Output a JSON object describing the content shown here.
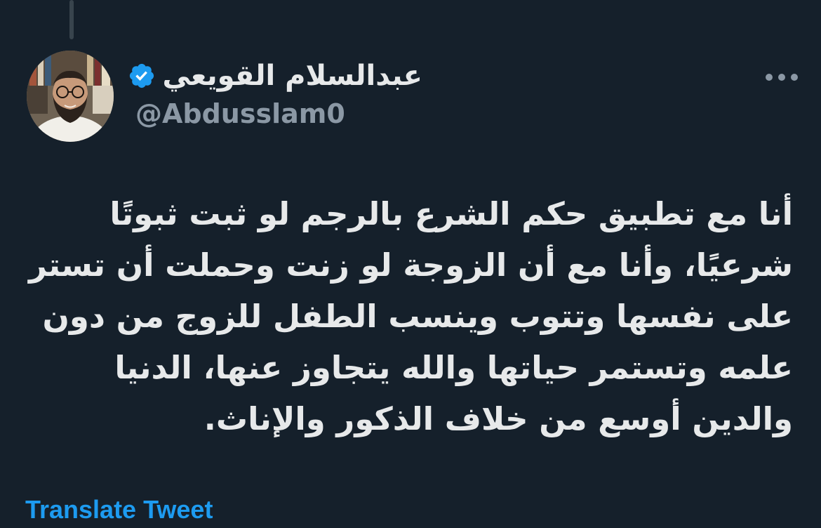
{
  "author": {
    "display_name": "عبدالسلام القويعي",
    "handle": "@Abdusslam0",
    "verified": true,
    "avatar_icon": "user-avatar-photo",
    "verified_icon": "verified-badge-icon"
  },
  "tweet": {
    "text": "أنا مع تطبيق حكم الشرع بالرجم لو ثبت ثبوتًا\nشرعيًا، وأنا مع أن الزوجة لو زنت وحملت أن تستر\nعلى نفسها وتتوب وينسب الطفل للزوج من دون\nعلمه وتستمر حياتها والله يتجاوز عنها، الدنيا\nوالدين أوسع من خلاف الذكور والإناث."
  },
  "actions": {
    "translate_label": "Translate Tweet",
    "more_icon": "more-options-icon"
  },
  "colors": {
    "background": "#15202b",
    "text_primary": "#e7e9ea",
    "text_secondary": "#8b98a5",
    "accent": "#1d9bf0"
  }
}
